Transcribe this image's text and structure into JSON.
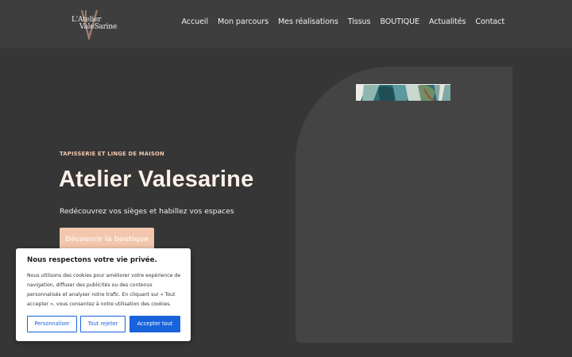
{
  "brand": {
    "logo_line1": "L'Atelier",
    "logo_line2": "ValeSarine"
  },
  "nav": {
    "items": [
      {
        "label": "Accueil"
      },
      {
        "label": "Mon parcours"
      },
      {
        "label": "Mes réalisations"
      },
      {
        "label": "Tissus"
      },
      {
        "label": "BOUTIQUE"
      },
      {
        "label": "Actualités"
      },
      {
        "label": "Contact"
      }
    ]
  },
  "hero": {
    "eyebrow": "TAPISSERIE ET LINGE DE MAISON",
    "title": "Atelier Valesarine",
    "subtitle": "Redécouvrez vos sièges et habillez vos espaces",
    "cta_label": "Découvrir la boutique"
  },
  "cookie": {
    "title": "Nous respectons votre vie privée.",
    "body": "Nous utilisons des cookies pour améliorer votre expérience de navigation, diffuser des publicités ou des contenus personnalisés et analyser notre trafic. En cliquant sur « Tout accepter », vous consentez à notre utilisation des cookies.",
    "customize_label": "Personnaliser",
    "reject_label": "Tout rejeter",
    "accept_label": "Accepter tout"
  },
  "colors": {
    "background": "#363636",
    "header": "#3e3e3e",
    "accent_peach": "#f2c7ad",
    "cookie_blue": "#1863dc"
  }
}
